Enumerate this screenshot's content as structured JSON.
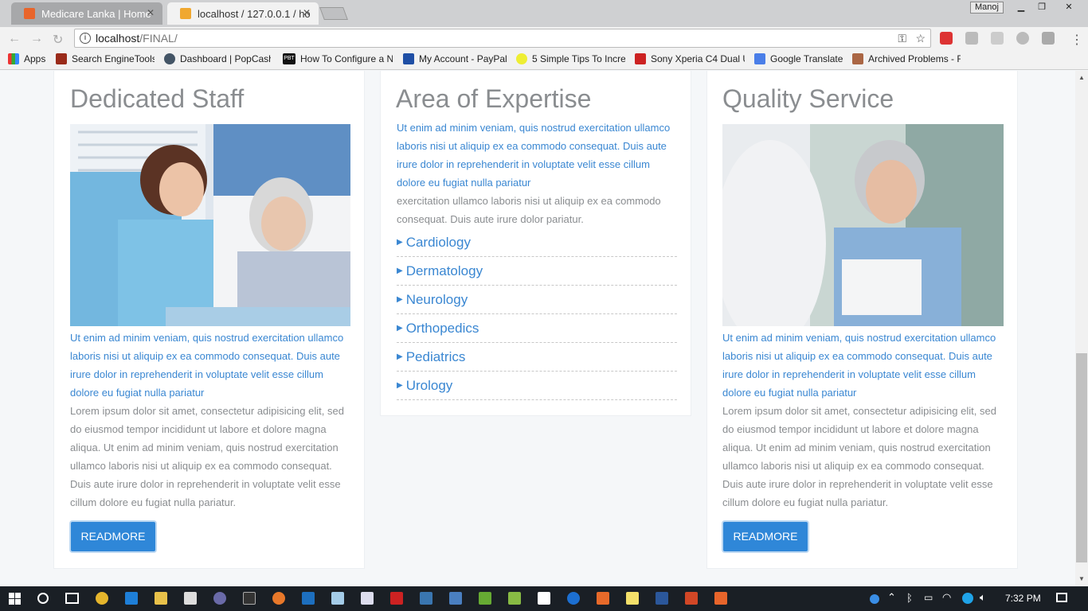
{
  "browser": {
    "tabs": [
      {
        "label": "Medicare Lanka | Home",
        "active": false
      },
      {
        "label": "localhost / 127.0.0.1 / ho",
        "active": true
      }
    ],
    "user": "Manoj",
    "url_host": "localhost",
    "url_path": "/FINAL/",
    "bookmarks": [
      "Apps",
      "Search EngineTools",
      "Dashboard | PopCash",
      "How To Configure a N",
      "My Account - PayPal",
      "5 Simple Tips To Incre",
      "Sony Xperia C4 Dual U",
      "Google Translate",
      "Archived Problems - F"
    ],
    "bookmark_icon": "PBT"
  },
  "cards": {
    "staff": {
      "title": "Dedicated Staff",
      "blue_text": "Ut enim ad minim veniam, quis nostrud exercitation ullamco laboris nisi ut aliquip ex ea commodo consequat. Duis aute irure dolor in reprehenderit in voluptate velit esse cillum dolore eu fugiat nulla pariatur",
      "grey_text": "Lorem ipsum dolor sit amet, consectetur adipisicing elit, sed do eiusmod tempor incididunt ut labore et dolore magna aliqua. Ut enim ad minim veniam, quis nostrud exercitation ullamco laboris nisi ut aliquip ex ea commodo consequat. Duis aute irure dolor in reprehenderit in voluptate velit esse cillum dolore eu fugiat nulla pariatur.",
      "button": "READMORE"
    },
    "expertise": {
      "title": "Area of Expertise",
      "blue_text": "Ut enim ad minim veniam, quis nostrud exercitation ullamco laboris nisi ut aliquip ex ea commodo consequat. Duis aute irure dolor in reprehenderit in voluptate velit esse cillum dolore eu fugiat nulla pariatur",
      "grey_text": "exercitation ullamco laboris nisi ut aliquip ex ea commodo consequat. Duis aute irure dolor pariatur.",
      "items": [
        "Cardiology",
        "Dermatology",
        "Neurology",
        "Orthopedics",
        "Pediatrics",
        "Urology"
      ]
    },
    "quality": {
      "title": "Quality Service",
      "blue_text": "Ut enim ad minim veniam, quis nostrud exercitation ullamco laboris nisi ut aliquip ex ea commodo consequat. Duis aute irure dolor in reprehenderit in voluptate velit esse cillum dolore eu fugiat nulla pariatur",
      "grey_text": "Lorem ipsum dolor sit amet, consectetur adipisicing elit, sed do eiusmod tempor incididunt ut labore et dolore magna aliqua. Ut enim ad minim veniam, quis nostrud exercitation ullamco laboris nisi ut aliquip ex ea commodo consequat. Duis aute irure dolor in reprehenderit in voluptate velit esse cillum dolore eu fugiat nulla pariatur.",
      "button": "READMORE"
    }
  },
  "taskbar": {
    "time": "7:32 PM"
  },
  "colors": {
    "accent": "#2f87d8",
    "link_text": "#3a87d2",
    "body_text": "#8a8d90"
  }
}
